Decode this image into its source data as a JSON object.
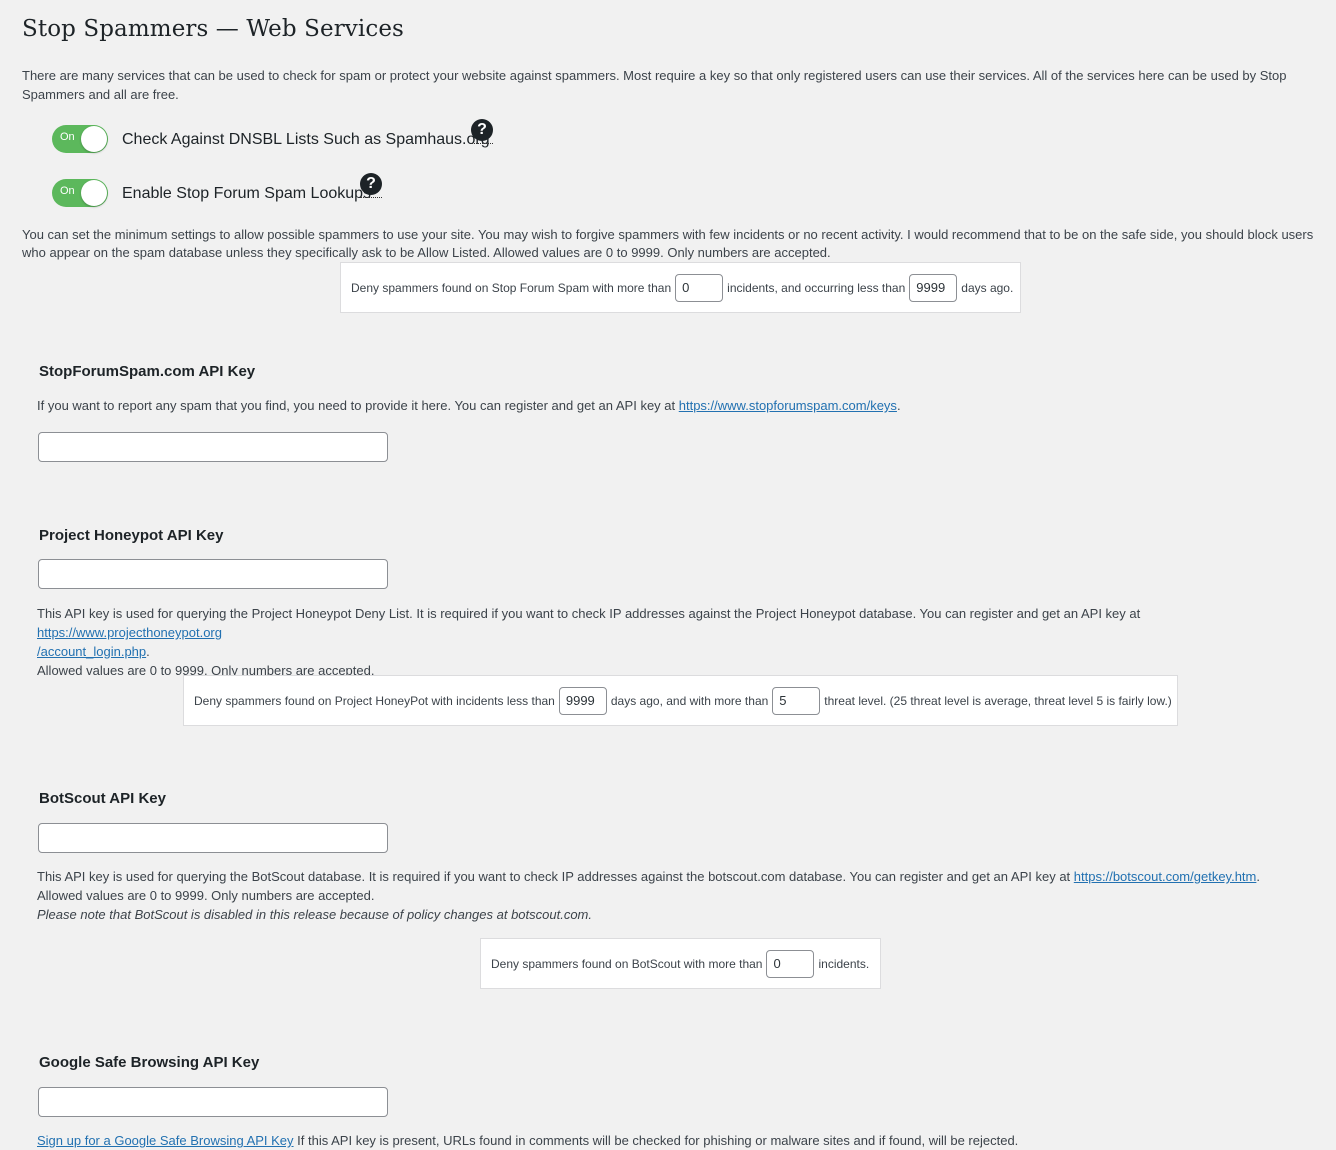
{
  "title": "Stop Spammers — Web Services",
  "intro": "There are many services that can be used to check for spam or protect your website against spammers. Most require a key so that only registered users can use their services. All of the services here can be used by Stop Spammers and all are free.",
  "toggles": [
    {
      "state": "On",
      "label": "Check Against DNSBL Lists Such as Spamhaus.org",
      "help": "?"
    },
    {
      "state": "On",
      "label": "Enable Stop Forum Spam Lookups",
      "help": "?"
    }
  ],
  "minimum_settings_text": "You can set the minimum settings to allow possible spammers to use your site. You may wish to forgive spammers with few incidents or no recent activity. I would recommend that to be on the safe side, you should block users who appear on the spam database unless they specifically ask to be Allow Listed. Allowed values are 0 to 9999. Only numbers are accepted.",
  "sfs_deny": {
    "prefix": "Deny spammers found on Stop Forum Spam with more than",
    "incidents": "0",
    "middle": "incidents, and occurring less than",
    "days": "9999",
    "suffix": "days ago."
  },
  "sfs_api": {
    "title": "StopForumSpam.com API Key",
    "desc_prefix": "If you want to report any spam that you find, you need to provide it here. You can register and get an API key at",
    "link": "https://www.stopforumspam.com/keys",
    "desc_suffix": ".",
    "value": ""
  },
  "honeypot_api": {
    "title": "Project Honeypot API Key",
    "value": "",
    "desc_prefix": "This API key is used for querying the Project Honeypot Deny List. It is required if you want to check IP addresses against the Project Honeypot database. You can register and get an API key at",
    "link_line1": "https://www.projecthoneypot.org",
    "link_line2": "/account_login.php",
    "desc_suffix": ".",
    "allowed": "Allowed values are 0 to 9999. Only numbers are accepted."
  },
  "honeypot_deny": {
    "prefix": "Deny spammers found on Project HoneyPot with incidents less than",
    "days": "9999",
    "middle": "days ago, and with more than",
    "threat": "5",
    "suffix": "threat level. (25 threat level is average, threat level 5 is fairly low.)"
  },
  "botscout_api": {
    "title": "BotScout API Key",
    "value": "",
    "desc_prefix": "This API key is used for querying the BotScout database. It is required if you want to check IP addresses against the botscout.com database. You can register and get an API key at",
    "link": "https://botscout.com/getkey.htm",
    "desc_suffix": ".",
    "allowed": "Allowed values are 0 to 9999. Only numbers are accepted.",
    "note": "Please note that BotScout is disabled in this release because of policy changes at botscout.com."
  },
  "botscout_deny": {
    "prefix": "Deny spammers found on BotScout with more than",
    "incidents": "0",
    "suffix": "incidents."
  },
  "google_api": {
    "title": "Google Safe Browsing API Key",
    "value": "",
    "link": "Sign up for a Google Safe Browsing API Key",
    "desc": "If this API key is present, URLs found in comments will be checked for phishing or malware sites and if found, will be rejected."
  }
}
